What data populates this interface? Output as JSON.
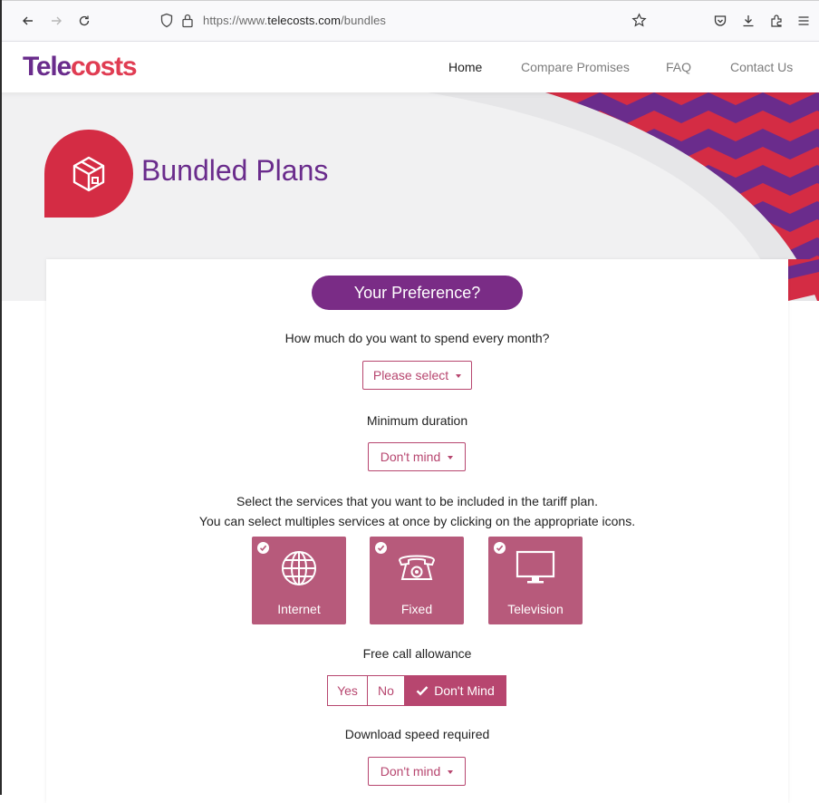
{
  "browser": {
    "url_prefix": "https://www.",
    "url_domain": "telecosts.com",
    "url_path": "/bundles",
    "icons": [
      "back-icon",
      "forward-icon",
      "reload-icon",
      "shield-icon",
      "lock-icon",
      "star-icon",
      "pocket-icon",
      "download-icon",
      "extensions-icon",
      "menu-icon"
    ]
  },
  "site": {
    "logo_part1": "Tele",
    "logo_part2": "costs",
    "nav": [
      {
        "label": "Home",
        "active": true
      },
      {
        "label": "Compare Promises",
        "active": false
      },
      {
        "label": "FAQ",
        "active": false
      },
      {
        "label": "Contact Us",
        "active": false
      }
    ]
  },
  "hero": {
    "title": "Bundled Plans",
    "icon": "box-icon"
  },
  "form": {
    "heading": "Your Preference?",
    "spend_question": "How much do you want to spend every month?",
    "spend_select": "Please select",
    "duration_label": "Minimum duration",
    "duration_select": "Don't mind",
    "services_line1": "Select the services that you want to be included in the tariff plan.",
    "services_line2": "You can select multiples services at once by clicking on the appropriate icons.",
    "services": [
      {
        "label": "Internet",
        "icon": "globe-icon",
        "selected": true
      },
      {
        "label": "Fixed",
        "icon": "telephone-icon",
        "selected": true
      },
      {
        "label": "Television",
        "icon": "monitor-icon",
        "selected": true
      }
    ],
    "calls_label": "Free call allowance",
    "calls_options": [
      "Yes",
      "No",
      "Don't Mind"
    ],
    "calls_selected": "Don't Mind",
    "speed_label": "Download speed required",
    "speed_select": "Don't mind"
  },
  "colors": {
    "purple": "#6a2c8c",
    "red": "#e03c52",
    "rose": "#b7466f",
    "tile": "#b75a7b"
  }
}
